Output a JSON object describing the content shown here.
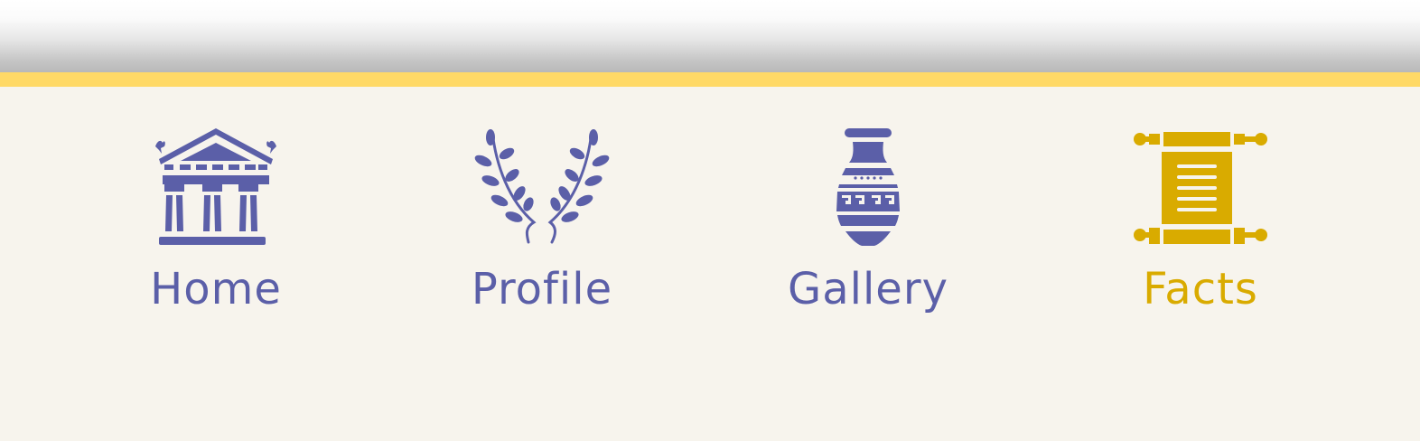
{
  "nav": {
    "items": [
      {
        "label": "Home",
        "icon": "temple-icon",
        "active": false
      },
      {
        "label": "Profile",
        "icon": "laurel-wreath-icon",
        "active": false
      },
      {
        "label": "Gallery",
        "icon": "amphora-vase-icon",
        "active": false
      },
      {
        "label": "Facts",
        "icon": "scroll-icon",
        "active": true
      }
    ]
  },
  "colors": {
    "accent": "#ffd966",
    "inactive": "#5b5fa8",
    "active": "#d9ab00",
    "background": "#f7f4ed"
  }
}
